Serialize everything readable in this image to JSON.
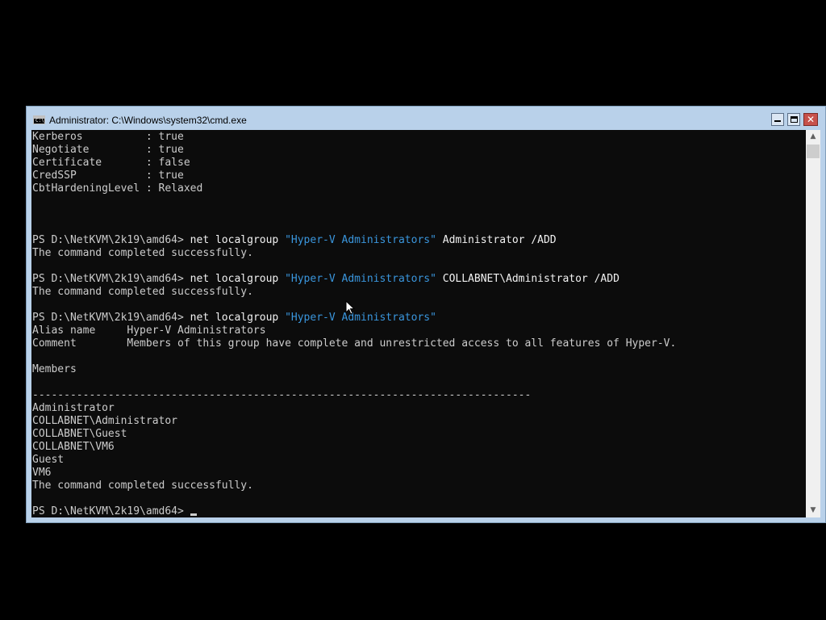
{
  "window": {
    "title": "Administrator: C:\\Windows\\system32\\cmd.exe",
    "icon": "cmd-console-icon",
    "controls": {
      "minimize": "minimize-icon",
      "maximize": "maximize-icon",
      "close": "✕"
    }
  },
  "terminal": {
    "lines": [
      {
        "text": "Kerberos          : true"
      },
      {
        "text": "Negotiate         : true"
      },
      {
        "text": "Certificate       : false"
      },
      {
        "text": "CredSSP           : true"
      },
      {
        "text": "CbtHardeningLevel : Relaxed"
      },
      {
        "text": ""
      },
      {
        "text": ""
      },
      {
        "text": ""
      },
      {
        "prompt": "PS D:\\NetKVM\\2k19\\amd64> ",
        "cmd": "net localgroup ",
        "str": "\"Hyper-V Administrators\"",
        "args": " Administrator /ADD"
      },
      {
        "text": "The command completed successfully."
      },
      {
        "text": ""
      },
      {
        "prompt": "PS D:\\NetKVM\\2k19\\amd64> ",
        "cmd": "net localgroup ",
        "str": "\"Hyper-V Administrators\"",
        "args": " COLLABNET\\Administrator /ADD"
      },
      {
        "text": "The command completed successfully."
      },
      {
        "text": ""
      },
      {
        "prompt": "PS D:\\NetKVM\\2k19\\amd64> ",
        "cmd": "net localgroup ",
        "str": "\"Hyper-V Administrators\"",
        "args": ""
      },
      {
        "text": "Alias name     Hyper-V Administrators"
      },
      {
        "text": "Comment        Members of this group have complete and unrestricted access to all features of Hyper-V."
      },
      {
        "text": ""
      },
      {
        "text": "Members"
      },
      {
        "text": ""
      },
      {
        "text": "-------------------------------------------------------------------------------"
      },
      {
        "text": "Administrator"
      },
      {
        "text": "COLLABNET\\Administrator"
      },
      {
        "text": "COLLABNET\\Guest"
      },
      {
        "text": "COLLABNET\\VM6"
      },
      {
        "text": "Guest"
      },
      {
        "text": "VM6"
      },
      {
        "text": "The command completed successfully."
      },
      {
        "text": ""
      },
      {
        "prompt": "PS D:\\NetKVM\\2k19\\amd64> ",
        "cursor": true
      }
    ]
  },
  "scrollbar": {
    "up_arrow": "▲",
    "down_arrow": "▼"
  },
  "colors": {
    "console_bg": "#0c0c0c",
    "console_text": "#cccccc",
    "string_token": "#3a96dd",
    "title_bar": "#b9d1ea",
    "close_button": "#c7514b"
  }
}
